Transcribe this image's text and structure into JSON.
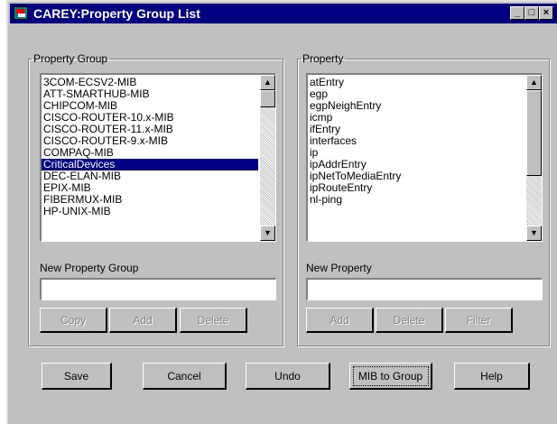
{
  "window": {
    "title": "CAREY:Property Group List",
    "controls": {
      "minimize": "_",
      "maximize": "□",
      "close": "×"
    }
  },
  "property_group": {
    "legend": "Property Group",
    "items": [
      "3COM-ECSV2-MIB",
      "ATT-SMARTHUB-MIB",
      "CHIPCOM-MIB",
      "CISCO-ROUTER-10.x-MIB",
      "CISCO-ROUTER-11.x-MIB",
      "CISCO-ROUTER-9.x-MIB",
      "COMPAQ-MIB",
      "CriticalDevices",
      "DEC-ELAN-MIB",
      "EPIX-MIB",
      "FIBERMUX-MIB",
      "HP-UNIX-MIB"
    ],
    "selected": "CriticalDevices",
    "new_label": "New Property Group",
    "new_value": "",
    "buttons": {
      "copy": "Copy",
      "add": "Add",
      "delete": "Delete"
    }
  },
  "property": {
    "legend": "Property",
    "items": [
      "atEntry",
      "egp",
      "egpNeighEntry",
      "icmp",
      "ifEntry",
      "interfaces",
      "ip",
      "ipAddrEntry",
      "ipNetToMediaEntry",
      "ipRouteEntry",
      "nl-ping"
    ],
    "new_label": "New Property",
    "new_value": "",
    "buttons": {
      "add": "Add",
      "delete": "Delete",
      "filter": "Filter"
    }
  },
  "actions": {
    "save": "Save",
    "cancel": "Cancel",
    "undo": "Undo",
    "mib_to_group": "MIB to Group",
    "help": "Help"
  },
  "icons": {
    "scroll_up": "▲",
    "scroll_down": "▼"
  },
  "colors": {
    "titlebar": "#000080",
    "face": "#c0c0c0",
    "selection": "#000080"
  }
}
